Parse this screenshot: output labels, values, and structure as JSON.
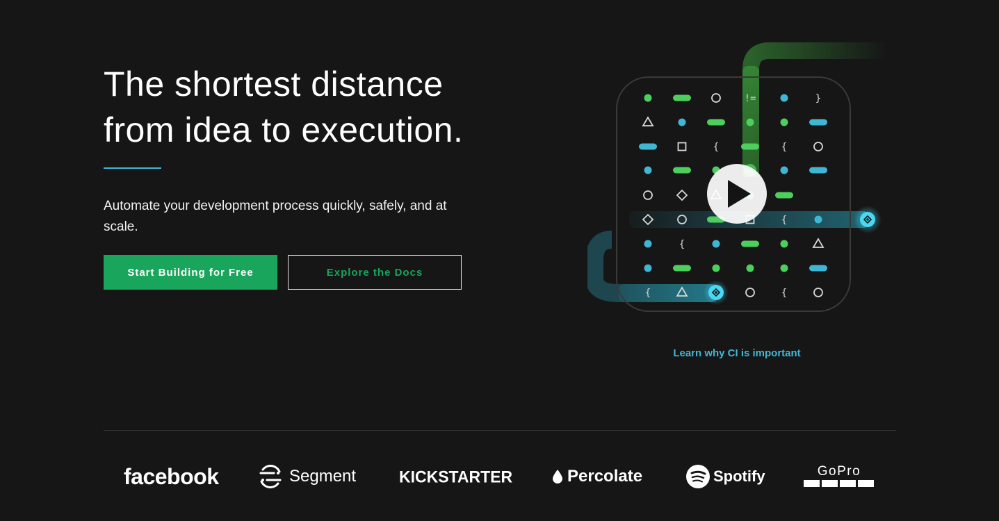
{
  "hero": {
    "title_line1": "The shortest distance",
    "title_line2": "from idea to execution.",
    "subtitle": "Automate your development process quickly, safely, and at scale.",
    "primary_cta": "Start Building for Free",
    "secondary_cta": "Explore the Docs",
    "learn_link": "Learn why CI is important"
  },
  "video": {
    "play_icon": "play-icon"
  },
  "logos": {
    "facebook": "facebook",
    "segment": "Segment",
    "kickstarter": "KICKSTARTER",
    "percolate": "Percolate",
    "spotify": "Spotify",
    "gopro": "GoPro"
  },
  "colors": {
    "background": "#161616",
    "brand_green": "#19a55c",
    "accent_blue": "#3fb7d4",
    "glyph_green": "#4ccf5c",
    "glyph_blue": "#3fb7d4"
  }
}
